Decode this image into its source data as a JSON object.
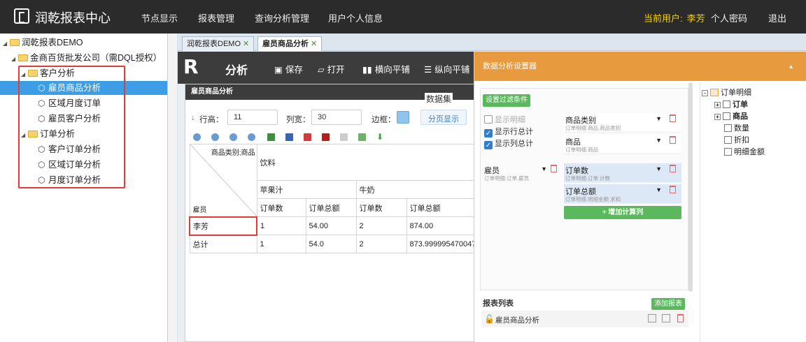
{
  "app": {
    "title": "润乾报表中心"
  },
  "nav": [
    "节点显示",
    "报表管理",
    "查询分析管理",
    "用户个人信息"
  ],
  "user": {
    "label": "当前用户:",
    "name": "李芳",
    "password": "个人密码",
    "logout": "退出"
  },
  "tree": {
    "root": "润乾报表DEMO",
    "company": "金商百货批发公司（需DQL授权）",
    "group1": "客户分析",
    "g1items": [
      "雇员商品分析",
      "区域月度订单",
      "雇员客户分析"
    ],
    "group2": "订单分析",
    "g2items": [
      "客户订单分析",
      "区域订单分析",
      "月度订单分析"
    ]
  },
  "tabs": [
    "润乾报表DEMO",
    "雇员商品分析"
  ],
  "toolbar": {
    "title": "分析",
    "save": "保存",
    "open": "打开",
    "htile": "横向平铺",
    "vtile": "纵向平铺"
  },
  "report": {
    "title": "雇员商品分析",
    "dataset": "数据集",
    "row_label": "行高：",
    "row_val": "11",
    "col_label": "列宽：",
    "col_val": "30",
    "border_label": "边框：",
    "page_btn": "分页显示"
  },
  "table": {
    "corner_top": "商品类别;商品",
    "corner_bottom": "雇员",
    "cat": "饮料",
    "prod1": "苹果汁",
    "prod2": "牛奶",
    "m1": "订单数",
    "m2": "订单总额",
    "m3": "订单数",
    "m4": "订单总额",
    "rows": [
      {
        "name": "李芳",
        "v": [
          "1",
          "54.00",
          "2",
          "874.00"
        ]
      },
      {
        "name": "总计",
        "v": [
          "1",
          "54.0",
          "2",
          "873.999995470047"
        ]
      }
    ]
  },
  "settings": {
    "title": "数据分析设置器",
    "filter_btn": "设置过滤条件",
    "show_detail": "显示明细",
    "show_row_total": "显示行总计",
    "show_col_total": "显示列总计",
    "cols": [
      {
        "t": "商品类别",
        "s": "订单明细.商品.商品类别"
      },
      {
        "t": "商品",
        "s": "订单明细.商品"
      }
    ],
    "row_field": {
      "t": "雇员",
      "s": "订单明细.订单.雇员"
    },
    "measures": [
      {
        "t": "订单数",
        "s": "订单明细.订单 计数"
      },
      {
        "t": "订单总额",
        "s": "订单明细.明细金额 求和"
      }
    ],
    "add_calc": "+ 增加计算列",
    "report_list": "报表列表",
    "add_report": "添加报表",
    "report_item": "雇员商品分析",
    "data_tree": {
      "root": "订单明细",
      "n1": "订单",
      "n2": "商品",
      "n3": "数量",
      "n4": "折扣",
      "n5": "明细金额"
    }
  }
}
